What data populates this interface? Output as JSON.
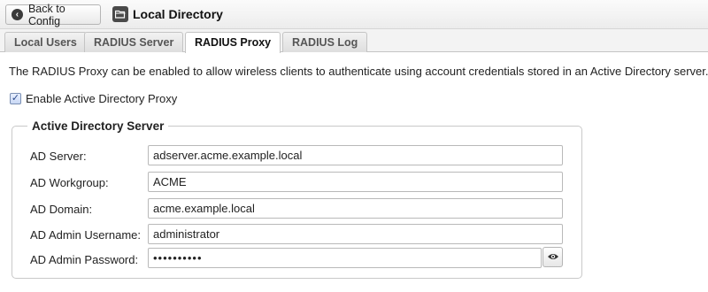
{
  "header": {
    "back_label": "Back to Config",
    "title": "Local Directory",
    "back_icon": "arrow-left-circle-icon",
    "title_icon": "folder-open-icon"
  },
  "tabs": [
    {
      "label": "Local Users",
      "active": false
    },
    {
      "label": "RADIUS Server",
      "active": false
    },
    {
      "label": "RADIUS Proxy",
      "active": true
    },
    {
      "label": "RADIUS Log",
      "active": false
    }
  ],
  "intro_text": "The RADIUS Proxy can be enabled to allow wireless clients to authenticate using account credentials stored in an Active Directory server.",
  "enable_proxy": {
    "label": "Enable Active Directory Proxy",
    "checked": true
  },
  "ad_server_section": {
    "legend": "Active Directory Server",
    "fields": [
      {
        "label": "AD Server:",
        "value": "adserver.acme.example.local"
      },
      {
        "label": "AD Workgroup:",
        "value": "ACME"
      },
      {
        "label": "AD Domain:",
        "value": "acme.example.local"
      },
      {
        "label": "AD Admin Username:",
        "value": "administrator"
      },
      {
        "label": "AD Admin Password:",
        "value": "••••••••••"
      }
    ],
    "show_password_icon": "eye-icon"
  }
}
